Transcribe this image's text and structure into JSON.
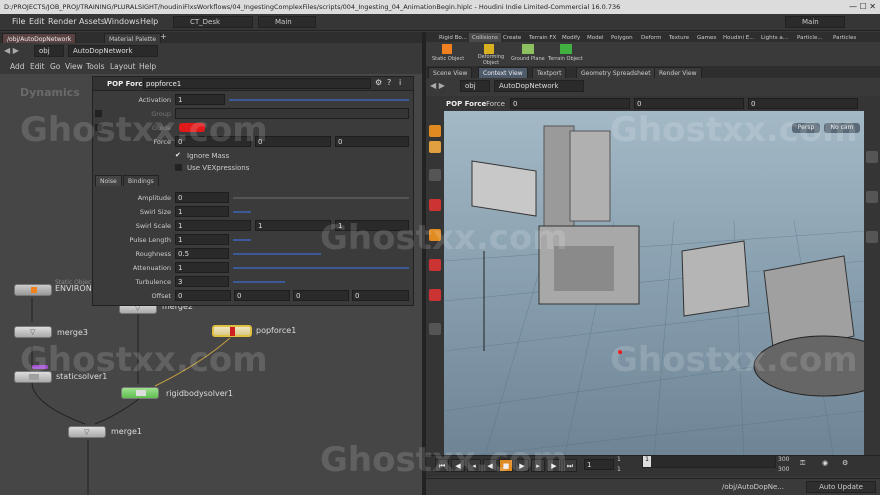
{
  "window": {
    "title": "D:/PROJECTS/JOB_PROJ/TRAINING/PLURALSIGHT/houdiniFlxsWorkflows/04_IngestingComplexFiles/scripts/004_Ingesting_04_AnimationBegin.hiplc - Houdini Indie Limited-Commercial 16.0.736"
  },
  "menu": {
    "items": [
      "File",
      "Edit",
      "Render",
      "Assets",
      "Windows",
      "Help"
    ],
    "desk": "CT_Desk",
    "main_left": "Main",
    "main_right": "Main"
  },
  "left": {
    "tabs": [
      "/obj/AutoDopNetwork",
      "Material Palette"
    ],
    "path": {
      "root": "obj",
      "network": "AutoDopNetwork"
    },
    "menu": [
      "Add",
      "Edit",
      "Go",
      "View",
      "Tools",
      "Layout",
      "Help"
    ],
    "context_label": "Dynamics",
    "nodes": {
      "environment": "ENVIRONM",
      "static_object_hint": "Static Objec",
      "merge3": "merge3",
      "merge2": "merge2",
      "popforce1": "popforce1",
      "staticsolver1": "staticsolver1",
      "rigidbodysolver1": "rigidbodysolver1",
      "merge1": "merge1"
    }
  },
  "params": {
    "node_type": "POP Force",
    "node_name": "popforce1",
    "activation": {
      "label": "Activation",
      "value": "1"
    },
    "group": {
      "label": "Group"
    },
    "guide": {
      "label": "Guide",
      "color": "#e01a1a"
    },
    "force": {
      "label": "Force",
      "x": "0",
      "y": "0",
      "z": "0"
    },
    "ignore_mass": "Ignore Mass",
    "use_vex": "Use VEXpressions",
    "subtabs": [
      "Noise",
      "Bindings"
    ],
    "amplitude": {
      "label": "Amplitude",
      "value": "0"
    },
    "swirl_size": {
      "label": "Swirl Size",
      "value": "1"
    },
    "swirl_scale": {
      "label": "Swirl Scale",
      "x": "1",
      "y": "1",
      "z": "1"
    },
    "pulse_length": {
      "label": "Pulse Length",
      "value": "1"
    },
    "roughness": {
      "label": "Roughness",
      "value": "0.5"
    },
    "attenuation": {
      "label": "Attenuation",
      "value": "1"
    },
    "turbulence": {
      "label": "Turbulence",
      "value": "3"
    },
    "offset": {
      "label": "Offset",
      "x": "0",
      "y": "0",
      "z": "0",
      "w": "0"
    }
  },
  "right": {
    "shelf_tabs": [
      "Rigid Bo...",
      "Collisions",
      "Create",
      "Terrain FX",
      "Modify",
      "Model",
      "Polygon",
      "Deform",
      "Texture",
      "Games",
      "Houdini E...",
      "Lights a...",
      "Particle...",
      "Particles"
    ],
    "shelf_tools": [
      "Static Object",
      "Deforming Object",
      "Ground Plane",
      "Terrain Object"
    ],
    "view_tabs": [
      "Scene View",
      "Context View",
      "Textport",
      "Geometry Spreadsheet",
      "Render View"
    ],
    "path": {
      "root": "obj",
      "network": "AutoDopNetwork"
    },
    "op_bar": {
      "type": "POP Force",
      "force_label": "Force",
      "x": "0",
      "y": "0",
      "z": "0"
    },
    "viewport": {
      "persp": "Persp",
      "cam": "No cam"
    }
  },
  "timeline": {
    "frame": "1",
    "start": "1",
    "start2": "1",
    "end": "300",
    "end2": "300"
  },
  "status": {
    "path": "/obj/AutoDopNe...",
    "auto_update": "Auto Update"
  },
  "watermark": "Ghostxx.com"
}
